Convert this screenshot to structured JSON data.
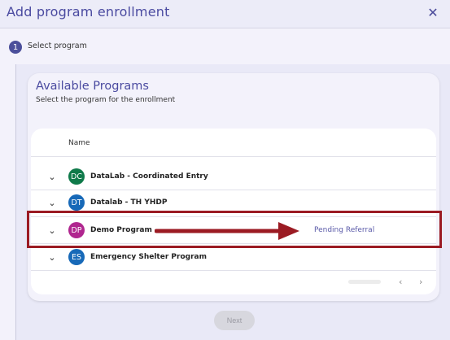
{
  "dialog": {
    "title": "Add program enrollment",
    "close_icon": "close-icon"
  },
  "stepper": {
    "step_number": "1",
    "step_label": "Select program"
  },
  "card": {
    "title": "Available Programs",
    "subtitle": "Select the program for the enrollment"
  },
  "table": {
    "column_header": "Name",
    "rows": [
      {
        "initials": "DC",
        "name": "DataLab - Coordinated Entry",
        "status": "",
        "avatar_color": "#0f7a4a"
      },
      {
        "initials": "DT",
        "name": "Datalab - TH YHDP",
        "status": "",
        "avatar_color": "#1769b8"
      },
      {
        "initials": "DP",
        "name": "Demo Program",
        "status": "Pending Referral",
        "avatar_color": "#b0268f"
      },
      {
        "initials": "ES",
        "name": "Emergency Shelter Program",
        "status": "",
        "avatar_color": "#1769b8"
      }
    ],
    "pager_prev": "‹",
    "pager_next": "›"
  },
  "footer": {
    "next_label": "Next"
  },
  "annotation": {
    "highlight_color": "#9b1b23"
  }
}
